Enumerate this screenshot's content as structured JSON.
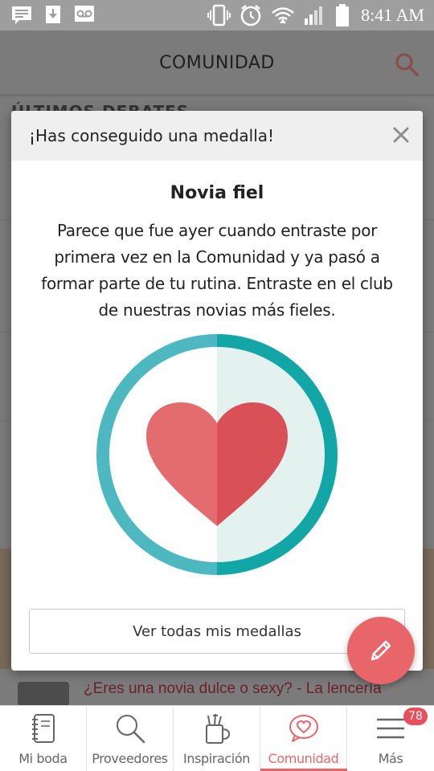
{
  "status_bar": {
    "time": "8:41 AM",
    "left_icons": [
      "message-icon",
      "download-icon",
      "voicemail-icon"
    ],
    "right_icons": [
      "vibrate-icon",
      "alarm-icon",
      "wifi-icon",
      "signal-icon",
      "battery-icon"
    ]
  },
  "header": {
    "title": "COMUNIDAD",
    "search_icon": "search-icon",
    "accent": "#e8666a"
  },
  "background": {
    "section_title": "ÚLTIMOS DEBATES",
    "article_title": "¿Eres una novia dulce o sexy? - La lencería"
  },
  "modal": {
    "header_title": "¡Has conseguido una medalla!",
    "close_icon": "close-icon",
    "badge_name": "Novia fiel",
    "badge_description": "Parece que fue ayer cuando entraste por primera vez en la Comunidad y ya pasó a formar parte de tu rutina. Entraste en el club de nuestras novias más fieles.",
    "medal_icon": "heart-medal-icon",
    "medal_colors": {
      "ring": "#4ab9bf",
      "fill": "#e4f2ef",
      "heart_left": "#e26b6d",
      "heart_right": "#d95257"
    },
    "all_medals_label": "Ver todas mis medallas"
  },
  "fab": {
    "icon": "pencil-icon",
    "color": "#e8666a"
  },
  "bottom_nav": {
    "items": [
      {
        "label": "Mi boda",
        "icon": "notebook-icon",
        "active": false
      },
      {
        "label": "Proveedores",
        "icon": "search-icon",
        "active": false
      },
      {
        "label": "Inspiración",
        "icon": "mug-icon",
        "active": false
      },
      {
        "label": "Comunidad",
        "icon": "heart-chat-icon",
        "active": true
      },
      {
        "label": "Más",
        "icon": "menu-icon",
        "active": false,
        "badge": "78"
      }
    ]
  }
}
